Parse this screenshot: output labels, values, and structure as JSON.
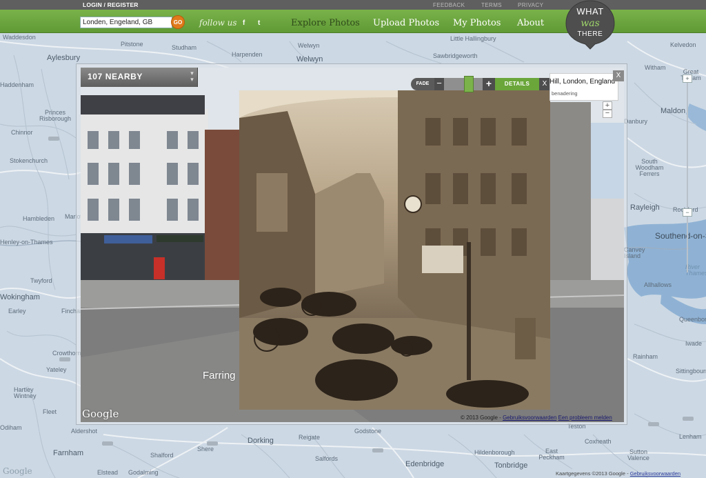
{
  "topbar": {
    "login_label": "LOGIN / REGISTER",
    "links": [
      "FEEDBACK",
      "TERMS",
      "PRIVACY"
    ]
  },
  "search": {
    "value": "Londen, Engeland, GB",
    "go_label": "GO"
  },
  "follow": {
    "label": "follow us",
    "facebook": "f",
    "twitter": "t"
  },
  "nav": {
    "items": [
      "Explore Photos",
      "Upload Photos",
      "My Photos",
      "About"
    ],
    "active": "Explore Photos"
  },
  "logo": {
    "line1": "WHAT",
    "line2": "was",
    "line3": "THERE"
  },
  "panel": {
    "nearby_label": "107 NEARBY",
    "fade_label": "FADE",
    "fade_minus": "−",
    "fade_plus": "+",
    "fade_level": 0.7,
    "details_label": "DETAILS",
    "details_close": "X",
    "info_title": "Hill, London, England",
    "info_subtitle": "benadering",
    "info_close": "X",
    "zoom_in": "+",
    "zoom_out": "−",
    "street_label": "Farring",
    "google_logo": "Google",
    "copyright": "© 2013 Google -",
    "terms_link": "Gebruiksvoorwaarden",
    "report_link": "Een probleem melden"
  },
  "map": {
    "places": [
      {
        "name": "Waddesdon"
      },
      {
        "name": "Pitstone"
      },
      {
        "name": "Studham"
      },
      {
        "name": "Harpenden"
      },
      {
        "name": "Welwyn"
      },
      {
        "name": "Welwyn"
      },
      {
        "name": "Little Hallingbury"
      },
      {
        "name": "Sawbridgeworth"
      },
      {
        "name": "Kelvedon"
      },
      {
        "name": "Aylesbury"
      },
      {
        "name": "Haddenham"
      },
      {
        "name": "Princes Risborough"
      },
      {
        "name": "Chinnor"
      },
      {
        "name": "Stokenchurch"
      },
      {
        "name": "Hambleden"
      },
      {
        "name": "Henley-on-Thames"
      },
      {
        "name": "Marlow"
      },
      {
        "name": "Twyford"
      },
      {
        "name": "Wokingham"
      },
      {
        "name": "Earley"
      },
      {
        "name": "Finchampstead"
      },
      {
        "name": "Crowthorne"
      },
      {
        "name": "Yateley"
      },
      {
        "name": "Hartley Wintney"
      },
      {
        "name": "Fleet"
      },
      {
        "name": "Odiham"
      },
      {
        "name": "Aldershot"
      },
      {
        "name": "Farnham"
      },
      {
        "name": "Elstead"
      },
      {
        "name": "Godalming"
      },
      {
        "name": "Shalford"
      },
      {
        "name": "Shere"
      },
      {
        "name": "Dorking"
      },
      {
        "name": "Reigate"
      },
      {
        "name": "Godstone"
      },
      {
        "name": "Salfords"
      },
      {
        "name": "Edenbridge"
      },
      {
        "name": "Hildenborough"
      },
      {
        "name": "Tonbridge"
      },
      {
        "name": "East Peckham"
      },
      {
        "name": "Coxheath"
      },
      {
        "name": "Sutton Valence"
      },
      {
        "name": "Lenham"
      },
      {
        "name": "Teston"
      },
      {
        "name": "Witham"
      },
      {
        "name": "Great Totham"
      },
      {
        "name": "Maldon"
      },
      {
        "name": "South Woodham Ferrers"
      },
      {
        "name": "Rayleigh"
      },
      {
        "name": "Rochford"
      },
      {
        "name": "Southend-on-Sea"
      },
      {
        "name": "Canvey Island"
      },
      {
        "name": "River Thames"
      },
      {
        "name": "Allhallows"
      },
      {
        "name": "Queenborough"
      },
      {
        "name": "Iwade"
      },
      {
        "name": "Rainham"
      },
      {
        "name": "Sittingbourne"
      },
      {
        "name": "Danbury"
      }
    ],
    "google_logo": "Google",
    "footer_text": "Kaartgegevens ©2013 Google -",
    "footer_link": "Gebruiksvoorwaarden",
    "zoom_in": "+",
    "zoom_out": "−"
  },
  "colors": {
    "brand_green": "#6aa63a",
    "topbar_gray": "#5f5f5f",
    "go_orange": "#e07a1a",
    "water": "#8fb2d4",
    "land": "#c9d6e2"
  },
  "icons": [
    "search-icon",
    "facebook-icon",
    "twitter-icon",
    "logo-pin-icon",
    "chevron-down-icon",
    "close-icon",
    "zoom-in-icon",
    "zoom-out-icon"
  ]
}
